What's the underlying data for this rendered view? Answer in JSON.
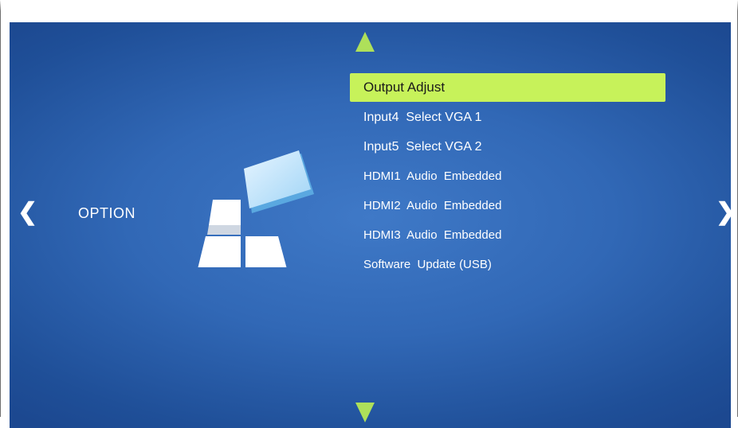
{
  "page": {
    "title": "OPTION",
    "nav_left_symbol": "❮",
    "nav_right_symbol": "❯"
  },
  "menu": {
    "items": [
      {
        "label": "Output Adjust",
        "selected": true
      },
      {
        "label": "Input4  Select VGA 1",
        "selected": false
      },
      {
        "label": "Input5  Select VGA 2",
        "selected": false
      },
      {
        "label": "HDMI1  Audio  Embedded",
        "selected": false
      },
      {
        "label": "HDMI2  Audio  Embedded",
        "selected": false
      },
      {
        "label": "HDMI3  Audio  Embedded",
        "selected": false
      },
      {
        "label": "Software  Update (USB)",
        "selected": false
      }
    ]
  },
  "colors": {
    "background": "#3168b6",
    "highlight": "#c7f25a",
    "arrow": "#aee05a",
    "text": "#ffffff"
  },
  "icons": {
    "scroll_up": "triangle-up-icon",
    "scroll_down": "triangle-down-icon",
    "option_logo": "option-tiles-icon"
  }
}
